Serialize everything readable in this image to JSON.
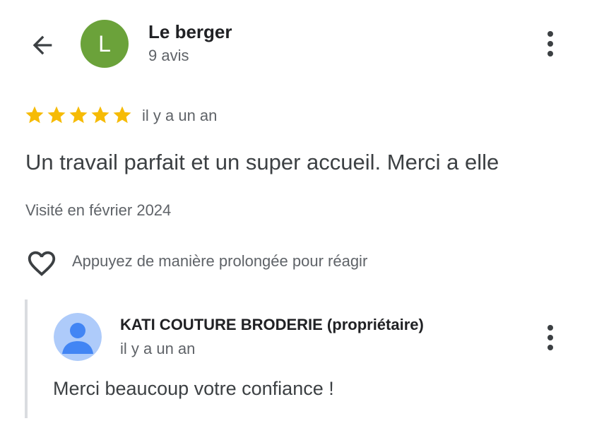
{
  "header": {
    "back_icon": "arrow-left-icon",
    "avatar_letter": "L",
    "avatar_color": "#6ba23a",
    "reviewer_name": "Le berger",
    "review_count": "9 avis",
    "menu_icon": "more-vert-icon"
  },
  "review": {
    "rating": 5,
    "rating_max": 5,
    "star_color": "#f6bb06",
    "date": "il y a un an",
    "text": "Un travail parfait et un super accueil. Merci a elle",
    "visited": "Visité en février 2024"
  },
  "react": {
    "icon": "heart-outline-icon",
    "hint": "Appuyez de manière prolongée pour réagir"
  },
  "owner_reply": {
    "avatar_icon": "default-person-avatar-icon",
    "avatar_bg": "#aecbfa",
    "avatar_fg": "#4285f4",
    "name": "KATI COUTURE BRODERIE (propriétaire)",
    "date": "il y a un an",
    "text": "Merci beaucoup votre confiance !",
    "menu_icon": "more-vert-icon"
  }
}
